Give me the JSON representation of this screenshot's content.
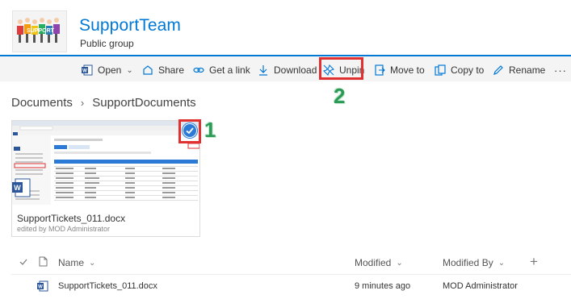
{
  "header": {
    "title": "SupportTeam",
    "subtitle": "Public group",
    "logo_text": "SUPPORT"
  },
  "commands": {
    "open": "Open",
    "share": "Share",
    "get_link": "Get a link",
    "download": "Download",
    "unpin": "Unpin",
    "move_to": "Move to",
    "copy_to": "Copy to",
    "rename": "Rename",
    "more": "···"
  },
  "callouts": {
    "one": "1",
    "two": "2"
  },
  "breadcrumb": {
    "root": "Documents",
    "separator": "›",
    "current": "SupportDocuments"
  },
  "tile": {
    "file_name": "SupportTickets_011.docx",
    "edited_by": "edited by MOD Administrator"
  },
  "list": {
    "columns": {
      "name": "Name",
      "modified": "Modified",
      "modified_by": "Modified By"
    },
    "add": "+",
    "rows": [
      {
        "name": "SupportTickets_011.docx",
        "modified": "9 minutes ago",
        "modified_by": "MOD Administrator"
      }
    ]
  },
  "colors": {
    "accent": "#0078d4",
    "highlight": "#e03030",
    "callout": "#2a9a55",
    "check": "#2b7bd6"
  }
}
